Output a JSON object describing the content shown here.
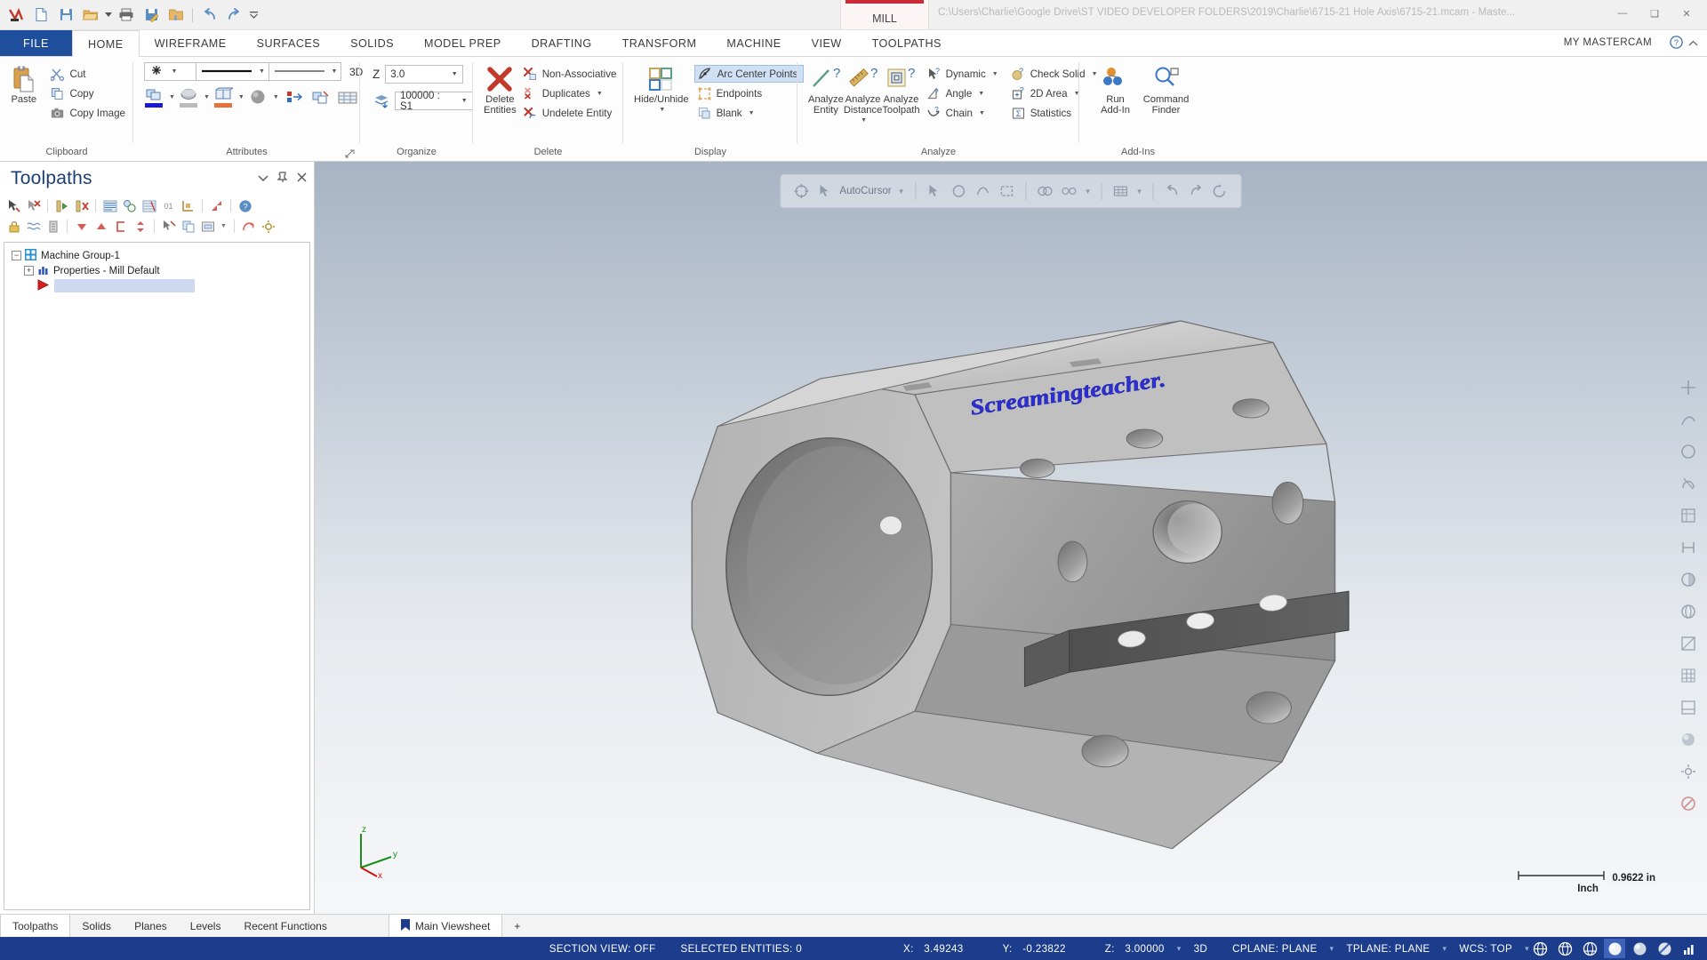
{
  "titlebar": {
    "mill_tab": "MILL",
    "doc_path": "C:\\Users\\Charlie\\Google Drive\\ST VIDEO DEVELOPER FOLDERS\\2019\\Charlie\\6715-21 Hole Axis\\6715-21.mcam - Maste...",
    "quick_access": [
      "mastercam-logo",
      "new-icon",
      "save-icon",
      "open-icon",
      "open-dropdown",
      "print-icon",
      "save-as-icon",
      "folder-icon",
      "undo-icon",
      "redo-icon",
      "qat-more-icon"
    ],
    "window_minimize": "—",
    "window_restore": "❑",
    "window_close": "✕"
  },
  "ribbon_tabs": {
    "file": "FILE",
    "tabs": [
      "HOME",
      "WIREFRAME",
      "SURFACES",
      "SOLIDS",
      "MODEL PREP",
      "DRAFTING",
      "TRANSFORM",
      "MACHINE",
      "VIEW",
      "TOOLPATHS"
    ],
    "active": "HOME",
    "my_mastercam": "MY MASTERCAM"
  },
  "ribbon": {
    "clipboard": {
      "name": "Clipboard",
      "paste": "Paste",
      "cut": "Cut",
      "copy": "Copy",
      "copy_image": "Copy Image"
    },
    "attributes": {
      "name": "Attributes",
      "point_style": "",
      "line_style": "",
      "line_width": "",
      "dim_mode": "3D"
    },
    "organize": {
      "name": "Organize",
      "z_label": "Z",
      "z_value": "3.0",
      "level_value": "100000 : S1"
    },
    "delete": {
      "name": "Delete",
      "delete_entities": "Delete\nEntities",
      "delete_entities_l1": "Delete",
      "delete_entities_l2": "Entities",
      "non_associative": "Non-Associative",
      "duplicates": "Duplicates",
      "undelete_entity": "Undelete Entity"
    },
    "display": {
      "name": "Display",
      "hide_unhide_l1": "Hide/Unhide",
      "arc_center_points": "Arc Center Points",
      "endpoints": "Endpoints",
      "blank": "Blank"
    },
    "analyze": {
      "name": "Analyze",
      "analyze_entity_l1": "Analyze",
      "analyze_entity_l2": "Entity",
      "analyze_distance_l1": "Analyze",
      "analyze_distance_l2": "Distance",
      "analyze_toolpath_l1": "Analyze",
      "analyze_toolpath_l2": "Toolpath",
      "dynamic": "Dynamic",
      "angle": "Angle",
      "chain": "Chain",
      "check_solid": "Check Solid",
      "area_2d": "2D Area",
      "statistics": "Statistics"
    },
    "addins": {
      "name": "Add-Ins",
      "run_addin_l1": "Run",
      "run_addin_l2": "Add-In",
      "command_finder_l1": "Command",
      "command_finder_l2": "Finder"
    }
  },
  "toolpaths_panel": {
    "title": "Toolpaths",
    "tree": {
      "machine_group": "Machine Group-1",
      "properties": "Properties - Mill Default",
      "toolpath_item": ""
    }
  },
  "viewport": {
    "autocursor_label": "AutoCursor",
    "scale_value": "0.9622 in",
    "scale_unit": "Inch",
    "part_text": "Screamingteacher.",
    "axis_x": "x",
    "axis_y": "y",
    "axis_z": "z"
  },
  "bottom_tabs": {
    "left": [
      "Toolpaths",
      "Solids",
      "Planes",
      "Levels",
      "Recent Functions"
    ],
    "viewsheet": "Main Viewsheet",
    "add": "+"
  },
  "statusbar": {
    "section_view": "SECTION VIEW: OFF",
    "selected_entities": "SELECTED ENTITIES: 0",
    "x_label": "X:",
    "x_value": "3.49243",
    "y_label": "Y:",
    "y_value": "-0.23822",
    "z_label": "Z:",
    "z_value": "3.00000",
    "mode_3d": "3D",
    "cplane": "CPLANE: PLANE",
    "tplane": "TPLANE: PLANE",
    "wcs": "WCS: TOP"
  },
  "colors": {
    "accent_blue": "#1c3c8c",
    "file_tab_blue": "#1f4e9c",
    "mill_red": "#cc2b38",
    "title_blue": "#1c3f73",
    "part_text_blue": "#2d2fd0",
    "selection_blue": "#cdd9ef"
  }
}
